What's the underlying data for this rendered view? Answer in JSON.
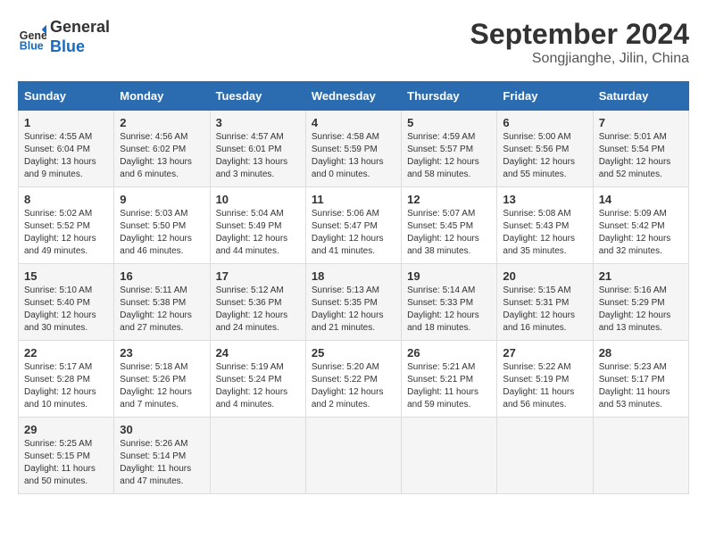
{
  "header": {
    "logo_line1": "General",
    "logo_line2": "Blue",
    "month": "September 2024",
    "location": "Songjianghe, Jilin, China"
  },
  "days_of_week": [
    "Sunday",
    "Monday",
    "Tuesday",
    "Wednesday",
    "Thursday",
    "Friday",
    "Saturday"
  ],
  "weeks": [
    [
      {
        "num": "1",
        "sunrise": "4:55 AM",
        "sunset": "6:04 PM",
        "daylight": "13 hours and 9 minutes."
      },
      {
        "num": "2",
        "sunrise": "4:56 AM",
        "sunset": "6:02 PM",
        "daylight": "13 hours and 6 minutes."
      },
      {
        "num": "3",
        "sunrise": "4:57 AM",
        "sunset": "6:01 PM",
        "daylight": "13 hours and 3 minutes."
      },
      {
        "num": "4",
        "sunrise": "4:58 AM",
        "sunset": "5:59 PM",
        "daylight": "13 hours and 0 minutes."
      },
      {
        "num": "5",
        "sunrise": "4:59 AM",
        "sunset": "5:57 PM",
        "daylight": "12 hours and 58 minutes."
      },
      {
        "num": "6",
        "sunrise": "5:00 AM",
        "sunset": "5:56 PM",
        "daylight": "12 hours and 55 minutes."
      },
      {
        "num": "7",
        "sunrise": "5:01 AM",
        "sunset": "5:54 PM",
        "daylight": "12 hours and 52 minutes."
      }
    ],
    [
      {
        "num": "8",
        "sunrise": "5:02 AM",
        "sunset": "5:52 PM",
        "daylight": "12 hours and 49 minutes."
      },
      {
        "num": "9",
        "sunrise": "5:03 AM",
        "sunset": "5:50 PM",
        "daylight": "12 hours and 46 minutes."
      },
      {
        "num": "10",
        "sunrise": "5:04 AM",
        "sunset": "5:49 PM",
        "daylight": "12 hours and 44 minutes."
      },
      {
        "num": "11",
        "sunrise": "5:06 AM",
        "sunset": "5:47 PM",
        "daylight": "12 hours and 41 minutes."
      },
      {
        "num": "12",
        "sunrise": "5:07 AM",
        "sunset": "5:45 PM",
        "daylight": "12 hours and 38 minutes."
      },
      {
        "num": "13",
        "sunrise": "5:08 AM",
        "sunset": "5:43 PM",
        "daylight": "12 hours and 35 minutes."
      },
      {
        "num": "14",
        "sunrise": "5:09 AM",
        "sunset": "5:42 PM",
        "daylight": "12 hours and 32 minutes."
      }
    ],
    [
      {
        "num": "15",
        "sunrise": "5:10 AM",
        "sunset": "5:40 PM",
        "daylight": "12 hours and 30 minutes."
      },
      {
        "num": "16",
        "sunrise": "5:11 AM",
        "sunset": "5:38 PM",
        "daylight": "12 hours and 27 minutes."
      },
      {
        "num": "17",
        "sunrise": "5:12 AM",
        "sunset": "5:36 PM",
        "daylight": "12 hours and 24 minutes."
      },
      {
        "num": "18",
        "sunrise": "5:13 AM",
        "sunset": "5:35 PM",
        "daylight": "12 hours and 21 minutes."
      },
      {
        "num": "19",
        "sunrise": "5:14 AM",
        "sunset": "5:33 PM",
        "daylight": "12 hours and 18 minutes."
      },
      {
        "num": "20",
        "sunrise": "5:15 AM",
        "sunset": "5:31 PM",
        "daylight": "12 hours and 16 minutes."
      },
      {
        "num": "21",
        "sunrise": "5:16 AM",
        "sunset": "5:29 PM",
        "daylight": "12 hours and 13 minutes."
      }
    ],
    [
      {
        "num": "22",
        "sunrise": "5:17 AM",
        "sunset": "5:28 PM",
        "daylight": "12 hours and 10 minutes."
      },
      {
        "num": "23",
        "sunrise": "5:18 AM",
        "sunset": "5:26 PM",
        "daylight": "12 hours and 7 minutes."
      },
      {
        "num": "24",
        "sunrise": "5:19 AM",
        "sunset": "5:24 PM",
        "daylight": "12 hours and 4 minutes."
      },
      {
        "num": "25",
        "sunrise": "5:20 AM",
        "sunset": "5:22 PM",
        "daylight": "12 hours and 2 minutes."
      },
      {
        "num": "26",
        "sunrise": "5:21 AM",
        "sunset": "5:21 PM",
        "daylight": "11 hours and 59 minutes."
      },
      {
        "num": "27",
        "sunrise": "5:22 AM",
        "sunset": "5:19 PM",
        "daylight": "11 hours and 56 minutes."
      },
      {
        "num": "28",
        "sunrise": "5:23 AM",
        "sunset": "5:17 PM",
        "daylight": "11 hours and 53 minutes."
      }
    ],
    [
      {
        "num": "29",
        "sunrise": "5:25 AM",
        "sunset": "5:15 PM",
        "daylight": "11 hours and 50 minutes."
      },
      {
        "num": "30",
        "sunrise": "5:26 AM",
        "sunset": "5:14 PM",
        "daylight": "11 hours and 47 minutes."
      },
      null,
      null,
      null,
      null,
      null
    ]
  ]
}
